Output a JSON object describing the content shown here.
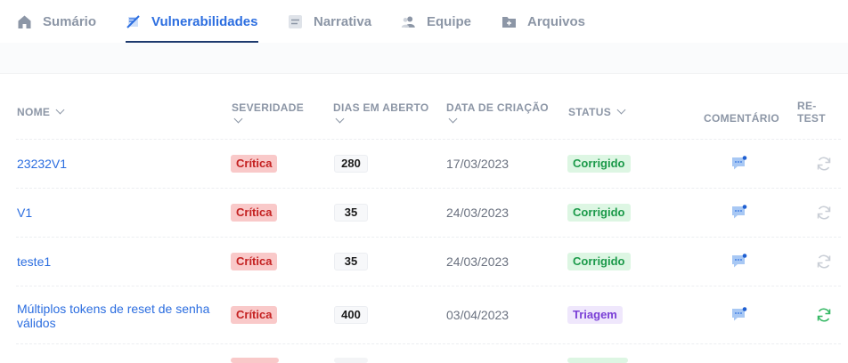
{
  "tabs": [
    {
      "label": "Sumário",
      "icon": "home-icon",
      "active": false
    },
    {
      "label": "Vulnerabilidades",
      "icon": "vulnerability-icon",
      "active": true
    },
    {
      "label": "Narrativa",
      "icon": "document-icon",
      "active": false
    },
    {
      "label": "Equipe",
      "icon": "team-icon",
      "active": false
    },
    {
      "label": "Arquivos",
      "icon": "folder-icon",
      "active": false
    }
  ],
  "table": {
    "columns": {
      "name": "NOME",
      "severity": "SEVERIDADE",
      "days_open": "DIAS EM ABERTO",
      "created": "DATA DE CRIAÇÃO",
      "status": "STATUS",
      "comment": "COMENTÁRIO",
      "retest_1": "RE-",
      "retest_2": "TEST"
    },
    "rows": [
      {
        "name": "23232V1",
        "severity": "Crítica",
        "days": "280",
        "date": "17/03/2023",
        "status": "Corrigido",
        "retest_active": false
      },
      {
        "name": "V1",
        "severity": "Crítica",
        "days": "35",
        "date": "24/03/2023",
        "status": "Corrigido",
        "retest_active": false
      },
      {
        "name": "teste1",
        "severity": "Crítica",
        "days": "35",
        "date": "24/03/2023",
        "status": "Corrigido",
        "retest_active": false
      },
      {
        "name_line1": "Múltiplos tokens de reset de senha",
        "name_line2": "válidos",
        "severity": "Crítica",
        "days": "400",
        "date": "03/04/2023",
        "status": "Triagem",
        "retest_active": true
      }
    ]
  },
  "colors": {
    "accent": "#2c6ee0",
    "critical_bg": "#f9c9c9",
    "critical_text": "#c42121",
    "fixed_bg": "#ddf6e3",
    "fixed_text": "#1c9a4a",
    "triage_bg": "#efe7fc",
    "triage_text": "#7a3fd6"
  }
}
